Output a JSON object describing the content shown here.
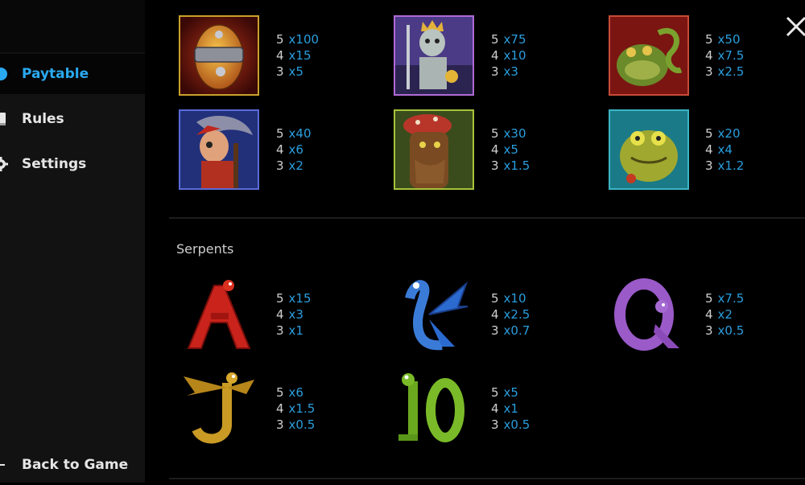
{
  "sidebar": {
    "items": [
      {
        "label": "Paytable",
        "icon": "info-icon"
      },
      {
        "label": "Rules",
        "icon": "book-icon"
      },
      {
        "label": "Settings",
        "icon": "gear-icon"
      }
    ],
    "back_label": "Back to Game"
  },
  "colors": {
    "accent": "#29a9f0",
    "multiplier": "#2a9ede",
    "sidebar_bg": "#121212",
    "page_bg": "#000000"
  },
  "premium_symbols": [
    {
      "name": "wild-egg",
      "pays": [
        {
          "count": "5",
          "mult": "x100"
        },
        {
          "count": "4",
          "mult": "x15"
        },
        {
          "count": "3",
          "mult": "x5"
        }
      ]
    },
    {
      "name": "skeleton-king",
      "pays": [
        {
          "count": "5",
          "mult": "x75"
        },
        {
          "count": "4",
          "mult": "x10"
        },
        {
          "count": "3",
          "mult": "x3"
        }
      ]
    },
    {
      "name": "frog-with-serpent",
      "pays": [
        {
          "count": "5",
          "mult": "x50"
        },
        {
          "count": "4",
          "mult": "x7.5"
        },
        {
          "count": "3",
          "mult": "x2.5"
        }
      ]
    },
    {
      "name": "old-wizard",
      "pays": [
        {
          "count": "5",
          "mult": "x40"
        },
        {
          "count": "4",
          "mult": "x6"
        },
        {
          "count": "3",
          "mult": "x2"
        }
      ]
    },
    {
      "name": "tree-troll",
      "pays": [
        {
          "count": "5",
          "mult": "x30"
        },
        {
          "count": "4",
          "mult": "x5"
        },
        {
          "count": "3",
          "mult": "x1.5"
        }
      ]
    },
    {
      "name": "toad-monster",
      "pays": [
        {
          "count": "5",
          "mult": "x20"
        },
        {
          "count": "4",
          "mult": "x4"
        },
        {
          "count": "3",
          "mult": "x1.2"
        }
      ]
    }
  ],
  "serpents": {
    "title": "Serpents",
    "symbols": [
      {
        "letter": "A",
        "pays": [
          {
            "count": "5",
            "mult": "x15"
          },
          {
            "count": "4",
            "mult": "x3"
          },
          {
            "count": "3",
            "mult": "x1"
          }
        ]
      },
      {
        "letter": "K",
        "pays": [
          {
            "count": "5",
            "mult": "x10"
          },
          {
            "count": "4",
            "mult": "x2.5"
          },
          {
            "count": "3",
            "mult": "x0.7"
          }
        ]
      },
      {
        "letter": "Q",
        "pays": [
          {
            "count": "5",
            "mult": "x7.5"
          },
          {
            "count": "4",
            "mult": "x2"
          },
          {
            "count": "3",
            "mult": "x0.5"
          }
        ]
      },
      {
        "letter": "J",
        "pays": [
          {
            "count": "5",
            "mult": "x6"
          },
          {
            "count": "4",
            "mult": "x1.5"
          },
          {
            "count": "3",
            "mult": "x0.5"
          }
        ]
      },
      {
        "letter": "10",
        "pays": [
          {
            "count": "5",
            "mult": "x5"
          },
          {
            "count": "4",
            "mult": "x1"
          },
          {
            "count": "3",
            "mult": "x0.5"
          }
        ]
      }
    ]
  }
}
